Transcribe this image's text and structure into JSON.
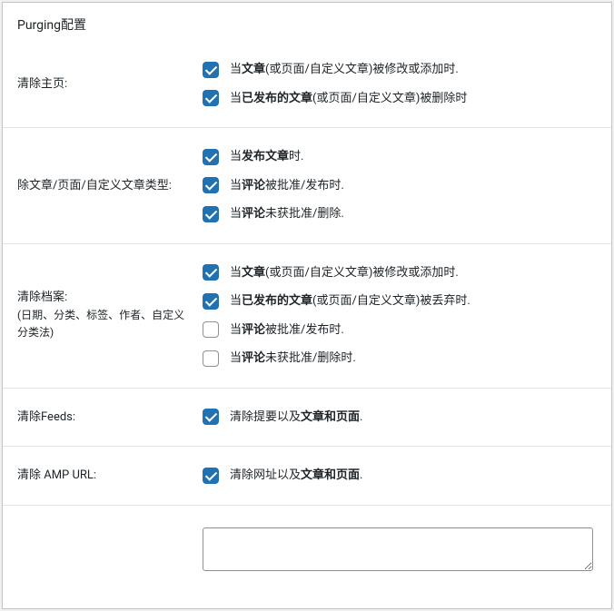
{
  "panel": {
    "title": "Purging配置"
  },
  "sections": {
    "homepage": {
      "label": "清除主页:",
      "options": [
        {
          "text_pre": "当",
          "bold": "文章",
          "text_post": "(或页面/自定义文章)被修改或添加时.",
          "checked": true
        },
        {
          "text_pre": "当",
          "bold": "已发布的文章",
          "text_post": "(或页面/自定义文章)被删除时",
          "checked": true
        }
      ]
    },
    "post": {
      "label": "除文章/页面/自定义文章类型:",
      "options": [
        {
          "text_pre": "当",
          "bold": "发布文章",
          "text_post": "时.",
          "checked": true
        },
        {
          "text_pre": "当",
          "bold": "评论",
          "text_post": "被批准/发布时.",
          "checked": true
        },
        {
          "text_pre": "当",
          "bold": "评论",
          "text_post": "未获批准/删除.",
          "checked": true
        }
      ]
    },
    "archive": {
      "label": "清除档案:",
      "sublabel": "(日期、分类、标签、作者、自定义分类法)",
      "options": [
        {
          "text_pre": "当",
          "bold": "文章",
          "text_post": "(或页面/自定义文章)被修改或添加时.",
          "checked": true
        },
        {
          "text_pre": "当",
          "bold": "已发布的文章",
          "text_post": "(或页面/自定义文章)被丢弃时.",
          "checked": true
        },
        {
          "text_pre": "当",
          "bold": "评论",
          "text_post": "被批准/发布时.",
          "checked": false
        },
        {
          "text_pre": "当",
          "bold": "评论",
          "text_post": "未获批准/删除时.",
          "checked": false
        }
      ]
    },
    "feeds": {
      "label": "清除Feeds:",
      "options": [
        {
          "text_pre": "清除提要以及",
          "bold": "文章和页面",
          "text_post": ".",
          "checked": true
        }
      ]
    },
    "amp": {
      "label": "清除 AMP URL:",
      "options": [
        {
          "text_pre": "清除网址以及",
          "bold": "文章和页面",
          "text_post": ".",
          "checked": true
        }
      ]
    }
  }
}
